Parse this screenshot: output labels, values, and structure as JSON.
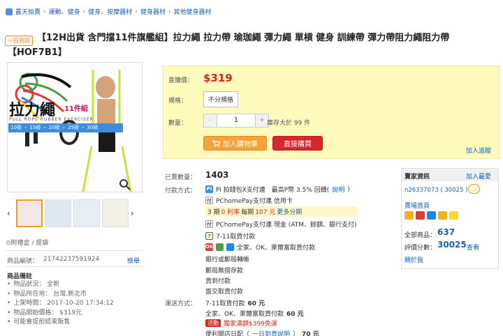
{
  "breadcrumb": [
    "露天拍賣",
    "運動、健身",
    "健身、按摩器材",
    "健身器材",
    "其他健身器材"
  ],
  "badge": "一日到貨",
  "title_line1": "【12H出貨 含門擋11件旗艦組】拉力繩 拉力帶 瑜珈繩 彈力繩 單槓 健身 訓練帶 彈力帶阻力繩阻力帶",
  "title_line2": "【HOF7B1】",
  "image": {
    "title": "拉力繩",
    "subtitle": "11件組",
    "english": "PULL ROPE RUBBER EXERCISER",
    "weights": "10磅 ・ 15磅 ・ 20磅 ・ 25磅 ・ 30磅"
  },
  "gift": "⊙附禮盒 / 提袋",
  "product_no_label": "商品編號：",
  "product_no": "21742237591924",
  "report": "檢舉",
  "notes_title": "商品備註",
  "notes": [
    "物品狀況： 全新",
    "物品所在地： 台灣,新北市",
    "上架時間： 2017-10-20 17:34:12",
    "物品開始價格： $319元",
    "可能會提前結束販售"
  ],
  "panel": {
    "price_label": "直購價：",
    "price": "$319",
    "spec_label": "規格：",
    "spec": "不分規格",
    "qty_label": "數量：",
    "qty_minus": "-",
    "qty": "1",
    "qty_plus": "+",
    "stock": "庫存大於 99 件",
    "add_cart": "加入購物車",
    "buy_now": "直接購買",
    "track": "加入追蹤"
  },
  "sold_label": "已賣數量：",
  "sold": "1403",
  "pay_label": "付款方式：",
  "pay": {
    "pi": "Pi 拍錢包X支付連　最高P幣 3.5% 回饋(",
    "pi_link": "說明",
    "pi_end": ")",
    "pchome1": "PChomePay支付連 信用卡",
    "inst_a": "3 期",
    "inst_b": "0 利率",
    "inst_c": "每期",
    "inst_d": "107 元",
    "inst_more": "更多分期",
    "pchome2": "PChomePay支付連 現金 (ATM、餘額、銀行支付)",
    "seven": "7-11取貨付款",
    "family": "全家、OK、萊爾富取貨付款",
    "bank": "銀行或郵局轉帳",
    "post": "郵局無摺存款",
    "cod": "貨到付款",
    "face": "面交取貨付款"
  },
  "ship_label": "運送方式：",
  "ship": {
    "s1_text": "7-11取貨付款",
    "s1_price": "60 元",
    "s2_text": "全家、OK、萊爾富取貨付款",
    "s2_price": "60 元",
    "promo_tag": "活動",
    "promo": "獨家滿額$399免運",
    "s3_text": "便利開店日配（",
    "s3_link": "一日到貨說明",
    "s3_end": "）",
    "s3_price": "70 元"
  },
  "seller": {
    "title": "賣家資訊",
    "fav": "加入最愛",
    "id": "n26337073",
    "score": "( 30025 )",
    "home": "賣場首頁",
    "total_label": "全部商品：",
    "total": "637",
    "rate_label": "評價分數：",
    "rate": "30025",
    "view": "查看",
    "about": "關於我"
  }
}
